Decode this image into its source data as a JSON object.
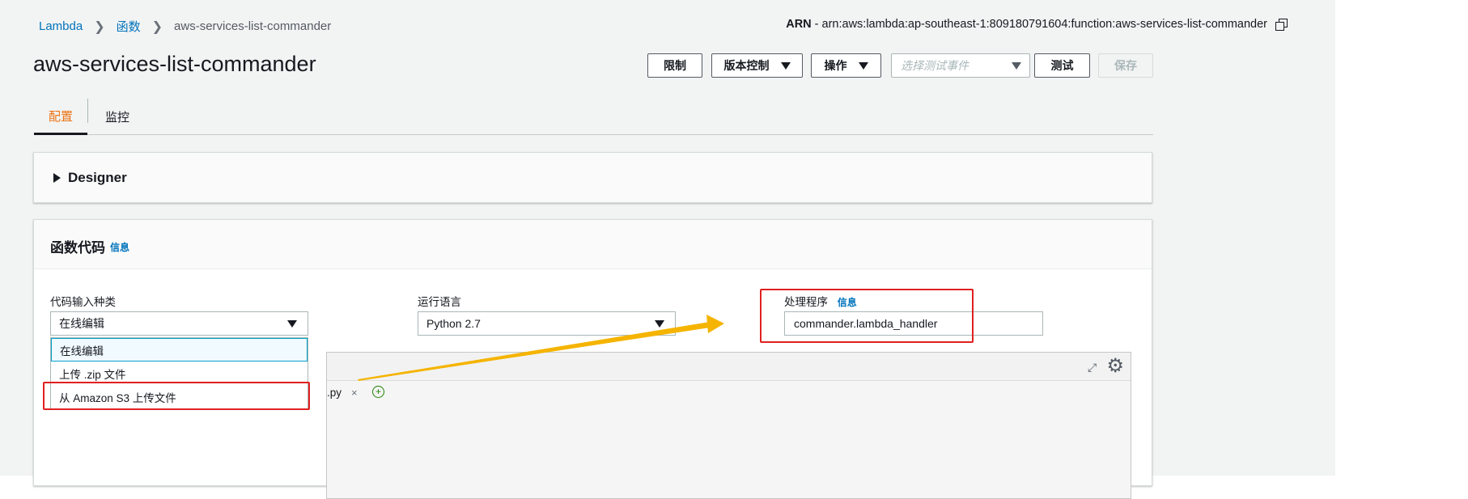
{
  "breadcrumb": {
    "items": [
      "Lambda",
      "函数",
      "aws-services-list-commander"
    ]
  },
  "arn": {
    "label": "ARN",
    "value": " - arn:aws:lambda:ap-southeast-1:809180791604:function:aws-services-list-commander"
  },
  "function_name": "aws-services-list-commander",
  "actions": {
    "throttle": "限制",
    "versioning": "版本控制",
    "operations": "操作",
    "test_event_placeholder": "选择测试事件",
    "test": "测试",
    "save": "保存"
  },
  "tabs": {
    "config": "配置",
    "monitor": "监控"
  },
  "designer": {
    "label": "Designer"
  },
  "function_code": {
    "title": "函数代码",
    "info": "信息",
    "code_entry_type_label": "代码输入种类",
    "code_entry_type_value": "在线编辑",
    "runtime_label": "运行语言",
    "runtime_value": "Python 2.7",
    "handler_label": "处理程序",
    "handler_info": "信息",
    "handler_value": "commander.lambda_handler",
    "dropdown_options": [
      "在线编辑",
      "上传 .zip 文件",
      "从 Amazon S3 上传文件"
    ],
    "file_tab": ".py",
    "file_tab_close": "×",
    "add_tab": "+"
  },
  "icons": {
    "copy": "copy-icon",
    "fullscreen": "fullscreen-icon",
    "settings": "gear-icon"
  },
  "colors": {
    "accent": "#ec7211",
    "link": "#0073bb",
    "annotation_red": "#e02020",
    "annotation_arrow": "#f5b400"
  }
}
